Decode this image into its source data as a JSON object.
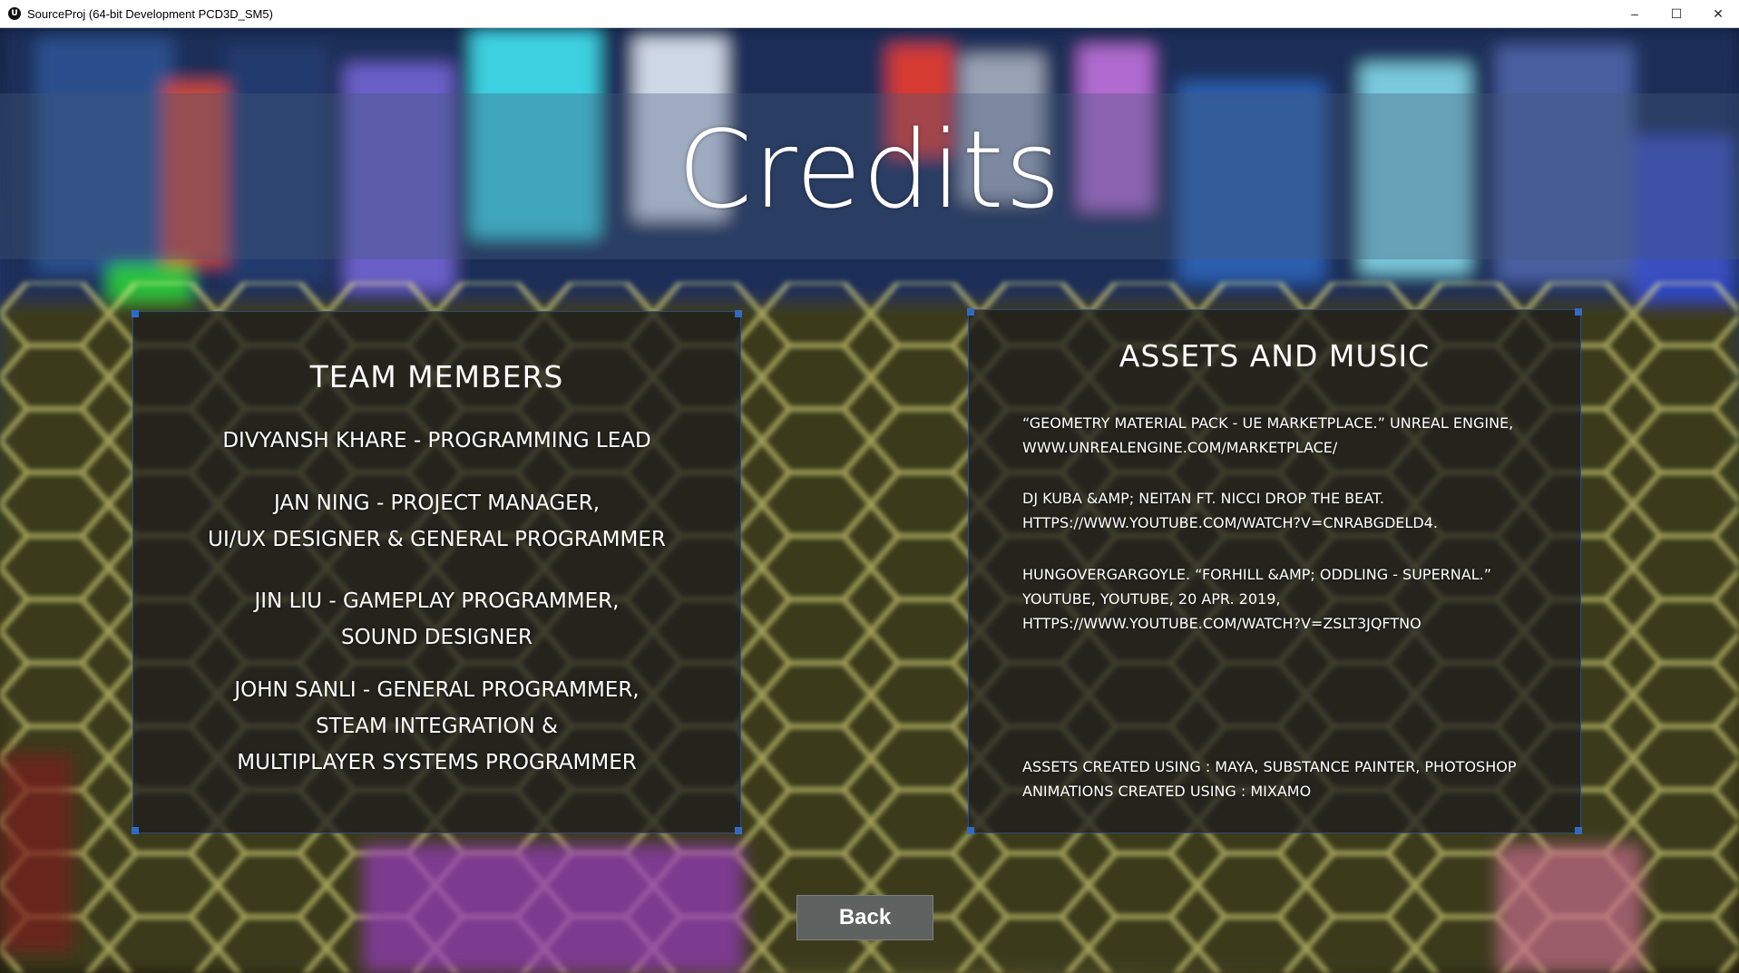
{
  "window": {
    "title": "SourceProj (64-bit Development PCD3D_SM5)",
    "app_icon": "unreal-engine-icon",
    "minimize_glyph": "–",
    "maximize_glyph": "☐",
    "close_glyph": "✕"
  },
  "screen": {
    "title": "Credits"
  },
  "team": {
    "heading": "TEAM MEMBERS",
    "members": [
      {
        "lines": [
          "DIVYANSH KHARE - PROGRAMMING LEAD"
        ]
      },
      {
        "lines": [
          "JAN NING - PROJECT MANAGER,",
          "UI/UX DESIGNER & GENERAL PROGRAMMER"
        ]
      },
      {
        "lines": [
          "JIN LIU - GAMEPLAY PROGRAMMER,",
          "SOUND DESIGNER"
        ]
      },
      {
        "lines": [
          "JOHN SANLI - GENERAL PROGRAMMER,",
          "STEAM INTEGRATION &",
          "MULTIPLAYER SYSTEMS PROGRAMMER"
        ]
      }
    ]
  },
  "assets": {
    "heading": "ASSETS AND MUSIC",
    "entries": [
      {
        "lines": [
          "“Geometry Material Pack - UE Marketplace.” Unreal Engine,",
          "www.unrealengine.com/marketplace/"
        ]
      },
      {
        "lines": [
          "DJ Kuba &amp; Neitan ft. Nicci Drop The Beat.",
          "https://www.youtube.com/watch?v=cnRaBGDeLD4."
        ]
      },
      {
        "lines": [
          "HungOverGargoyle. “Forhill &amp; Oddling - Supernal.”",
          "YouTube, YouTube, 20 Apr. 2019,",
          "https://www.youtube.com/watch?v=zSlT3JqFtno"
        ]
      },
      {
        "lines": [
          "Assets Created Using : Maya, Substance Painter, Photoshop",
          "Animations Created Using : Mixamo"
        ]
      }
    ]
  },
  "buttons": {
    "back_label": "Back"
  }
}
